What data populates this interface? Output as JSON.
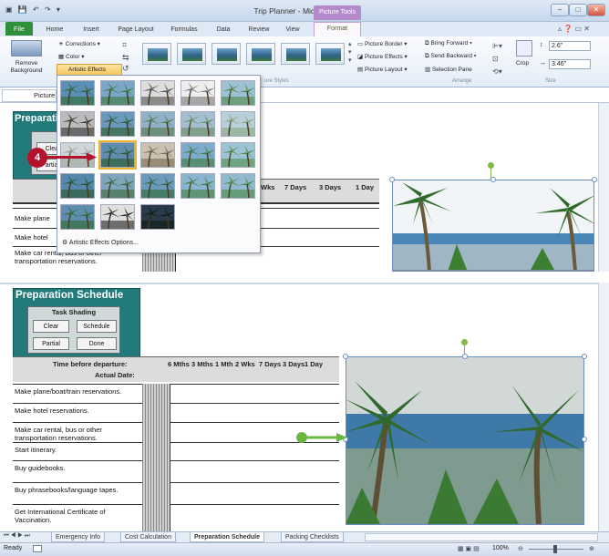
{
  "window": {
    "title": "Trip Planner - Microsoft Excel",
    "context_tab": "Picture Tools"
  },
  "ribbon_tabs": [
    "File",
    "Home",
    "Insert",
    "Page Layout",
    "Formulas",
    "Data",
    "Review",
    "View",
    "Format"
  ],
  "ribbon": {
    "remove_background": "Remove Background",
    "corrections": "Corrections",
    "color": "Color",
    "artistic_effects": "Artistic Effects",
    "picture_styles_group": "ure Styles",
    "picture_border": "Picture Border",
    "picture_effects": "Picture Effects",
    "picture_layout": "Picture Layout",
    "bring_forward": "Bring Forward",
    "send_backward": "Send Backward",
    "selection_pane": "Selection Pane",
    "arrange_group": "Arrange",
    "crop": "Crop",
    "height": "2.6\"",
    "width": "3.46\"",
    "size_group": "Size"
  },
  "formula_bar": {
    "name_box": "Picture"
  },
  "dropdown": {
    "options_label": "Artistic Effects Options...",
    "step_badge": "4"
  },
  "sheet": {
    "title": "Preparation Schedule",
    "task_shading": "Task Shading",
    "buttons": {
      "clear": "Clear",
      "schedule": "Schedule",
      "partial": "Partial",
      "done": "Done"
    },
    "time_before": "Time before departure:",
    "actual_date": "Actual Date:",
    "columns": [
      "6 Mths",
      "3 Mths",
      "1 Mth",
      "2 Wks",
      "7 Days",
      "3 Days",
      "1 Day"
    ],
    "top_columns": [
      "Wks",
      "7 Days",
      "3 Days",
      "1 Day"
    ],
    "tasks": [
      "Make plane/boat/train reservations.",
      "Make hotel reservations.",
      "Make car rental, bus or other transportation reservations.",
      "Start itinerary.",
      "Buy guidebooks.",
      "Buy phrasebooks/language tapes.",
      "Get International Certificate of Vaccination."
    ],
    "top_tasks": [
      "Make plane",
      "Make hotel",
      "Make car rental, bus or other",
      "transportation reservations."
    ]
  },
  "sheet_tabs": [
    "Emergency Info",
    "Cost Calculation",
    "Preparation Schedule",
    "Packing Checklists"
  ],
  "status": {
    "ready": "Ready",
    "zoom": "100%"
  }
}
